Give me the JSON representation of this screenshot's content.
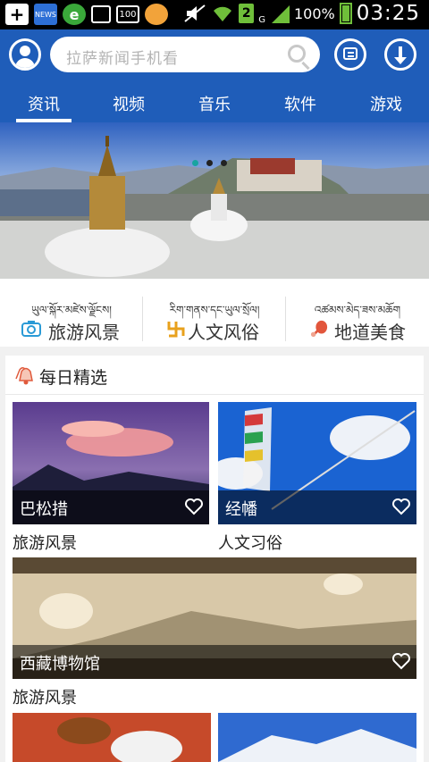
{
  "status_bar": {
    "news_badge": "NEWS",
    "battery_pct": "100%",
    "sim_slot": "2",
    "network": "G",
    "box_badge": "100",
    "time": "03:25"
  },
  "header": {
    "search_placeholder": "拉萨新闻手机看"
  },
  "tabs": [
    {
      "label": "资讯",
      "active": true
    },
    {
      "label": "视频"
    },
    {
      "label": "音乐"
    },
    {
      "label": "软件"
    },
    {
      "label": "游戏"
    }
  ],
  "banner": {
    "active_index": 0,
    "count": 3
  },
  "categories": [
    {
      "tibetan": "ཡུལ་སྐོར་མཛེས་ལྗོངས།",
      "label": "旅游风景",
      "icon": "camera-icon"
    },
    {
      "tibetan": "རིག་གནས་དང་ཡུལ་སྲོལ།",
      "label": "人文风俗",
      "icon": "swastika-icon"
    },
    {
      "tibetan": "འཚམས་མེད་ཟས་མཆོག",
      "label": "地道美食",
      "icon": "drumstick-icon"
    }
  ],
  "daily": {
    "title": "每日精选",
    "cards": [
      {
        "caption": "巴松措",
        "category": "旅游风景"
      },
      {
        "caption": "经幡",
        "category": "人文习俗"
      },
      {
        "caption": "西藏博物馆",
        "category": "旅游风景"
      }
    ]
  },
  "colors": {
    "brand_blue": "#1f5db9",
    "accent_teal": "#18a4a0"
  }
}
